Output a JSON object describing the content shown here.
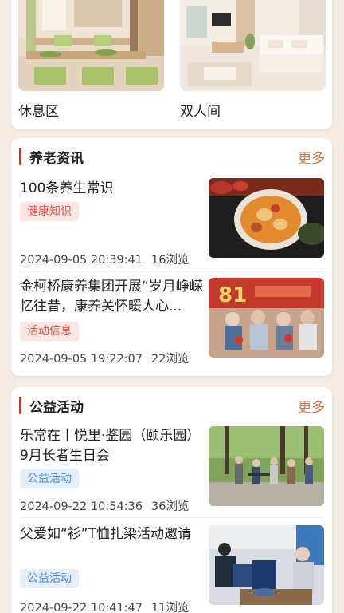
{
  "rooms": [
    {
      "label": "休息区"
    },
    {
      "label": "双人间"
    }
  ],
  "news": {
    "title": "养老资讯",
    "more": "更多",
    "items": [
      {
        "title": "100条养生常识",
        "tag": "健康知识",
        "date": "2024-09-05 20:39:41",
        "views": "16浏览"
      },
      {
        "title": "金柯桥康养集团开展“岁月峥嵘忆往昔，康养关怀暖人心...",
        "tag": "活动信息",
        "date": "2024-09-05 19:22:07",
        "views": "22浏览",
        "thumb_text": "81"
      }
    ]
  },
  "charity": {
    "title": "公益活动",
    "more": "更多",
    "items": [
      {
        "title": "乐常在丨悦里·鉴园（颐乐园）9月长者生日会",
        "tag": "公益活动",
        "date": "2024-09-22 10:54:36",
        "views": "36浏览"
      },
      {
        "title": "父爱如“衫”T恤扎染活动邀请",
        "tag": "公益活动",
        "date": "2024-09-22 10:41:47",
        "views": "11浏览"
      }
    ]
  },
  "colors": {
    "accent": "#b53a2e",
    "more": "#d1794a",
    "tag_red": "#e0564b",
    "tag_blue": "#4a89d9",
    "background": "#f6ece6"
  }
}
